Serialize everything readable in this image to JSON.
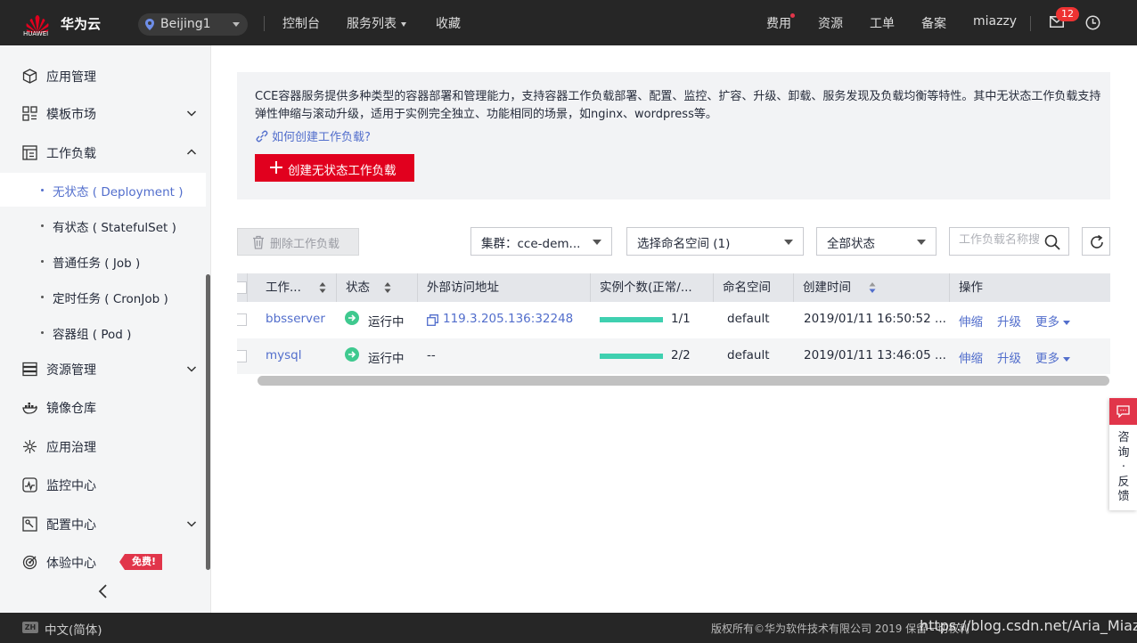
{
  "header": {
    "brand": "华为云",
    "logo_text": "HUAWEI",
    "region": "Beijing1",
    "nav": [
      "控制台",
      "服务列表",
      "收藏"
    ],
    "right": [
      "费用",
      "资源",
      "工单",
      "备案",
      "miazzy"
    ],
    "message_count": "12"
  },
  "sidebar": {
    "items": [
      {
        "label": "应用管理",
        "icon": "cube-icon"
      },
      {
        "label": "模板市场",
        "icon": "grid-icon"
      },
      {
        "label": "工作负载",
        "icon": "workload-icon"
      },
      {
        "label": "资源管理",
        "icon": "server-icon"
      },
      {
        "label": "镜像仓库",
        "icon": "whale-icon"
      },
      {
        "label": "应用治理",
        "icon": "mesh-icon"
      },
      {
        "label": "监控中心",
        "icon": "monitor-icon"
      },
      {
        "label": "配置中心",
        "icon": "config-icon"
      },
      {
        "label": "体验中心",
        "icon": "target-icon"
      }
    ],
    "subitems": [
      "无状态 ( Deployment )",
      "有状态 ( StatefulSet )",
      "普通任务 ( Job )",
      "定时任务 ( CronJob )",
      "容器组 ( Pod )"
    ],
    "free_badge": "免费!"
  },
  "banner": {
    "description": "CCE容器服务提供多种类型的容器部署和管理能力，支持容器工作负载部署、配置、监控、扩容、升级、卸载、服务发现及负载均衡等特性。其中无状态工作负载支持弹性伸缩与滚动升级，适用于实例完全独立、功能相同的场景，如nginx、wordpress等。",
    "help_link": "如何创建工作负载?",
    "create_button": "创建无状态工作负载"
  },
  "toolbar": {
    "delete_button": "删除工作负载",
    "cluster_select": "集群：cce-dem...",
    "namespace_select": "选择命名空间 (1)",
    "status_select": "全部状态",
    "search_placeholder": "工作负载名称搜索"
  },
  "table": {
    "columns": [
      "工作...",
      "状态",
      "外部访问地址",
      "实例个数(正常/...",
      "命名空间",
      "创建时间",
      "操作"
    ],
    "rows": [
      {
        "name": "bbsserver",
        "status": "运行中",
        "address": "119.3.205.136:32248",
        "instances": "1/1",
        "ready_fraction": 1.0,
        "namespace": "default",
        "created": "2019/01/11 16:50:52 ..."
      },
      {
        "name": "mysql",
        "status": "运行中",
        "address": "--",
        "instances": "2/2",
        "ready_fraction": 1.0,
        "namespace": "default",
        "created": "2019/01/11 13:46:05 ..."
      }
    ],
    "actions": [
      "伸缩",
      "升级",
      "更多"
    ]
  },
  "feedback": {
    "label": "咨询·反馈"
  },
  "footer": {
    "lang_code": "ZH",
    "lang": "中文(简体)",
    "copyright": "版权所有©华为软件技术有限公司 2019 保留一切权利",
    "watermark": "https://blog.csdn.net/Aria_Miazzy"
  }
}
